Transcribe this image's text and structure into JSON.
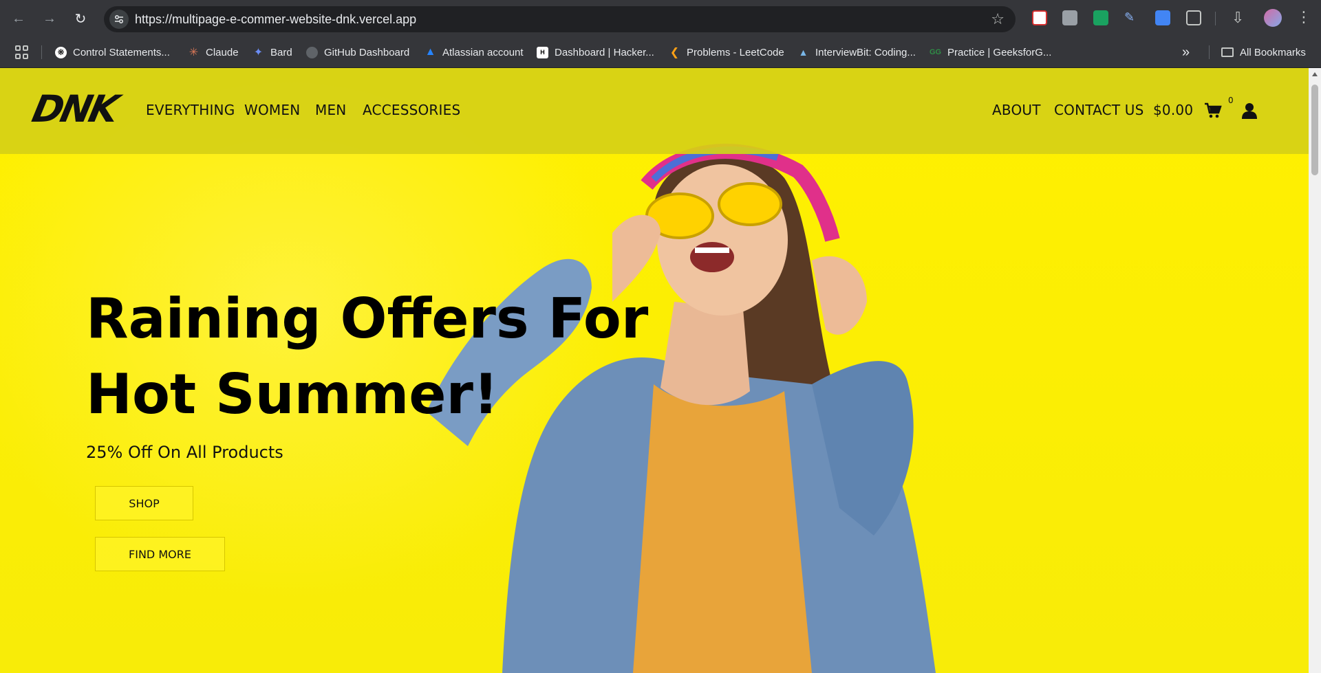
{
  "browser": {
    "url": "https://multipage-e-commer-website-dnk.vercel.app",
    "bookmarks": [
      {
        "label": "Control Statements...",
        "icon": "chatgpt-icon"
      },
      {
        "label": "Claude",
        "icon": "claude-icon"
      },
      {
        "label": "Bard",
        "icon": "bard-icon"
      },
      {
        "label": "GitHub Dashboard",
        "icon": "github-icon"
      },
      {
        "label": "Atlassian account",
        "icon": "atlassian-icon"
      },
      {
        "label": "Dashboard | Hacker...",
        "icon": "hackerrank-icon"
      },
      {
        "label": "Problems - LeetCode",
        "icon": "leetcode-icon"
      },
      {
        "label": "InterviewBit: Coding...",
        "icon": "interviewbit-icon"
      },
      {
        "label": "Practice | GeeksforG...",
        "icon": "geeksforgeeks-icon"
      }
    ],
    "overflow_label": "»",
    "all_bookmarks": "All Bookmarks"
  },
  "site": {
    "logo": "DNK",
    "nav_left": [
      "EVERYTHING",
      "WOMEN",
      "MEN",
      "ACCESSORIES"
    ],
    "nav_right": [
      "ABOUT",
      "CONTACT US"
    ],
    "cart_total": "$0.00",
    "cart_count": "0"
  },
  "hero": {
    "title_line1": "Raining Offers For",
    "title_line2": "Hot Summer!",
    "subtitle": "25% Off On All Products",
    "shop_button": "SHOP",
    "find_more_button": "FIND MORE"
  },
  "colors": {
    "hero_yellow": "#fff000",
    "header_overlay": "#d6d016",
    "chrome_dark": "#35363a"
  }
}
